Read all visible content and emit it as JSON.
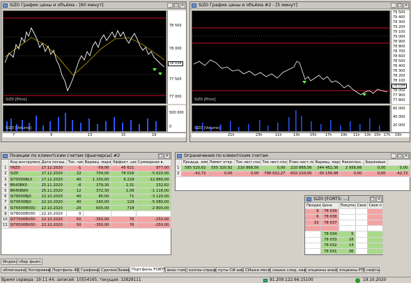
{
  "chart1": {
    "title": "SiZ0 График цены и объёма - [60 минут]",
    "price_label": "SiZ0 [Price]",
    "volume_label": "SiZ0 [Volume]",
    "y_ticks": [
      "78 500",
      "78 000",
      "77 500",
      "77 000"
    ],
    "price_tag": "78 034",
    "vol_ticks": [
      "500 000",
      "0"
    ],
    "x_ticks": [
      "7",
      "9",
      "13",
      "15",
      "19"
    ]
  },
  "chart2": {
    "title": "SiZ0 График цены и объёма #2 - [5 минут]",
    "price_label": "SiZ0 [Price]",
    "volume_label": "SiZ0 [Volume]",
    "y_ticks": [
      "79 500",
      "79 400",
      "79 300",
      "79 200",
      "79 100",
      "79 000",
      "78 900",
      "78 800",
      "78 700",
      "78 600",
      "78 500",
      "78 400",
      "78 300",
      "78 200",
      "78 100",
      "78 000",
      "77 900",
      "77 800"
    ],
    "price_tag": "78 034",
    "vol_ticks": [
      "60 000",
      "40 000",
      "20 000"
    ],
    "x_ticks": [
      "21h",
      "23h",
      "11h",
      "13h",
      "15h",
      "17h",
      "19h",
      "11h",
      "13h",
      "15h",
      "17h",
      "19h"
    ]
  },
  "positions": {
    "title": "Позиции по клиентским счетам (фьючерсы) #2",
    "headers": [
      "",
      "Код инструмента",
      "Дата погаш.",
      "Тек. чист.поз.",
      "Вариац. маржа",
      "Эффект. цена",
      "Суммарная в."
    ],
    "rows": [
      {
        "n": "1",
        "code": "YNZ0",
        "date": "17.12.2020",
        "pos": "-1",
        "var": "-59,00",
        "eff": "45 621",
        "sum": "977,00",
        "st": "red"
      },
      {
        "n": "2",
        "code": "SiZ0",
        "date": "17.12.2020",
        "pos": "22",
        "var": "704,00",
        "eff": "78 016",
        "sum": "-5 620,00",
        "st": "grn"
      },
      {
        "n": "3",
        "code": "SI75000BL0",
        "date": "17.12.2020",
        "pos": "40",
        "var": "1 330,00",
        "eff": "6 229",
        "sum": "-12 880,00",
        "st": "grn"
      },
      {
        "n": "4",
        "code": "BR43BK0",
        "date": "25.11.2020",
        "pos": "-6",
        "var": "279,30",
        "eff": "2,31",
        "sum": "232,62",
        "st": "grn"
      },
      {
        "n": "5",
        "code": "BR40BW0",
        "date": "25.11.2020",
        "pos": "12",
        "var": "372,30",
        "eff": "1,08",
        "sum": "-1 116,00",
        "st": "grn"
      },
      {
        "n": "6",
        "code": "SI79000BJ0",
        "date": "22.10.2020",
        "pos": "40",
        "var": "80,00",
        "eff": "71",
        "sum": "-3 120,00",
        "st": "grn"
      },
      {
        "n": "7",
        "code": "SI79500BJ0",
        "date": "22.10.2020",
        "pos": "40",
        "var": "160,00",
        "eff": "129",
        "sum": "-5 080,00",
        "st": "grn"
      },
      {
        "n": "8",
        "code": "SI76500BV0D",
        "date": "22.10.2020",
        "pos": "-20",
        "var": "600,00",
        "eff": "718",
        "sum": "-2 800,00",
        "st": "grn"
      },
      {
        "n": "9",
        "code": "SI78000BV0D",
        "date": "22.10.2020",
        "pos": "0",
        "var": "",
        "eff": "",
        "sum": "",
        "st": "wht"
      },
      {
        "n": "10",
        "code": "SI77000BV0D",
        "date": "22.10.2020",
        "pos": "50",
        "var": "-350,00",
        "eff": "76",
        "sum": "-250,00",
        "st": "red"
      },
      {
        "n": "11",
        "code": "SI76500BV0D",
        "date": "22.10.2020",
        "pos": "50",
        "var": "-350,00",
        "eff": "76",
        "sum": "-250,00",
        "st": "red"
      }
    ]
  },
  "limits": {
    "title": "Ограничения по клиентским счетам",
    "headers": [
      "",
      "Предыд. лимит",
      "Лимит откр. п.",
      "Тек.чист.поз.",
      "Тек.чист.поз. (",
      "План.чист.поз.",
      "Вариац. маржа",
      "Накоплен. д.",
      "Биржевые"
    ],
    "rows": [
      {
        "n": "1",
        "c": [
          "585 520,62",
          "555 320,92",
          "210 868,56",
          "0,00",
          "210 868,56",
          "344 452,36",
          "2 956,66",
          "0,00",
          "0,00"
        ],
        "st": "grn"
      },
      {
        "n": "2",
        "c": [
          "-42,72",
          "0,00",
          "0,00",
          "798 022,27",
          "602 210,00",
          "-30 156,98",
          "0,00",
          "0,00",
          "-42,72"
        ],
        "st": "red"
      }
    ]
  },
  "orderbook": {
    "title": "SiZ0 [FORTS: ...]",
    "headers": [
      "Продаж",
      "Цена",
      "Покупка",
      "Своя",
      "Своя п"
    ],
    "rows": [
      {
        "sell": "9",
        "price": "78 039",
        "buy": "",
        "side": "s"
      },
      {
        "sell": "6",
        "price": "78 038",
        "buy": "",
        "side": "s"
      },
      {
        "sell": "15",
        "price": "78 037",
        "buy": "",
        "side": "s"
      },
      {
        "sell": "",
        "price": "",
        "buy": "",
        "side": "s"
      },
      {
        "sell": "",
        "price": "78 034",
        "buy": "5",
        "side": "b"
      },
      {
        "sell": "",
        "price": "78 033",
        "buy": "18",
        "side": "b"
      },
      {
        "sell": "",
        "price": "78 032",
        "buy": "14",
        "side": "b"
      },
      {
        "sell": "",
        "price": "78 031",
        "buy": "36",
        "side": "b"
      }
    ]
  },
  "small_tabs": [
    "Индекс",
    "сбер фьюч"
  ],
  "bottom_tabs": [
    "облигашки",
    "Котировки",
    "Портфель ФР",
    "Графики",
    "Сделки/Заявки",
    "Портфель FORTS",
    "вкас-том",
    "коллы-спреды",
    "путы СИ-шка",
    "СИшка месяц",
    "сишка след. квартал",
    "опционы анализ",
    "опционы РТС",
    "нефть-"
  ],
  "active_tab": "Портфель FORTS",
  "status": {
    "server_time": "Время сервера: 19:11:44; записей: 10554165; текущая: 32828111",
    "ip": "91.209.122.66:15100",
    "date": "19.10.2020"
  },
  "colors": {
    "red_row": "#f3a3a3",
    "green_row": "#a9d98a",
    "chart_bg": "#000000",
    "price_line": "#ffffff",
    "ma_line": "#ffd400",
    "level_line": "#c8102e"
  }
}
